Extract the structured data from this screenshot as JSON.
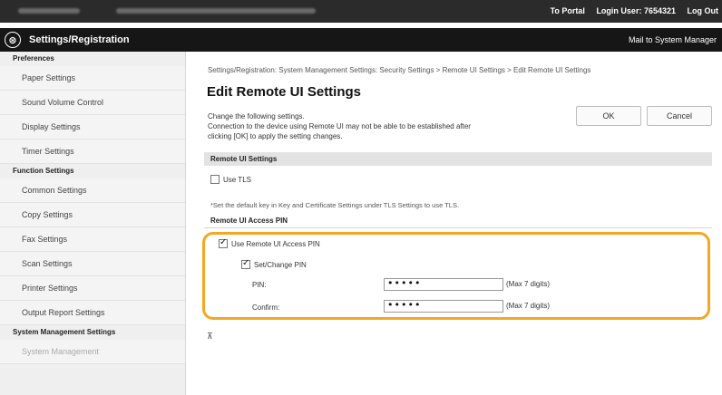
{
  "topbar": {
    "to_portal": "To Portal",
    "login_user": "Login User: 7654321",
    "log_out": "Log Out"
  },
  "titlebar": {
    "logo_glyph": "⊛",
    "title": "Settings/Registration",
    "mailto": "Mail to System Manager"
  },
  "sidebar": {
    "preferences_label": "Preferences",
    "preferences_items": [
      "Paper Settings",
      "Sound Volume Control",
      "Display Settings",
      "Timer Settings"
    ],
    "function_label": "Function Settings",
    "function_items": [
      "Common Settings",
      "Copy Settings",
      "Fax Settings",
      "Scan Settings",
      "Printer Settings",
      "Output Report Settings"
    ],
    "system_label": "System Management Settings",
    "system_items": [
      "System Management"
    ]
  },
  "main": {
    "breadcrumb": "Settings/Registration: System Management Settings: Security Settings > Remote UI Settings > Edit Remote UI Settings",
    "title": "Edit Remote UI Settings",
    "note_line1": "Change the following settings.",
    "note_line2": "Connection to the device using Remote UI may not be able to be established after",
    "note_line3": "clicking [OK] to apply the setting changes.",
    "ok_label": "OK",
    "cancel_label": "Cancel",
    "section_title": "Remote UI Settings",
    "use_tls_label": "Use TLS",
    "use_tls_checked": false,
    "tls_hint": "*Set the default key in Key and Certificate Settings under TLS Settings to use TLS.",
    "pin_section": "Remote UI Access PIN",
    "use_pin_label": "Use Remote UI Access PIN",
    "use_pin_checked": true,
    "set_change_pin_label": "Set/Change PIN",
    "set_change_pin_checked": true,
    "pin_label": "PIN:",
    "pin_value": "•••••",
    "pin_max": "(Max 7 digits)",
    "confirm_label": "Confirm:",
    "confirm_value": "•••••",
    "confirm_max": "(Max 7 digits)",
    "to_top_glyph": "⊼"
  },
  "colors": {
    "highlight": "#f5a623",
    "topbar": "#2b2b2b",
    "titlebar": "#161616"
  }
}
